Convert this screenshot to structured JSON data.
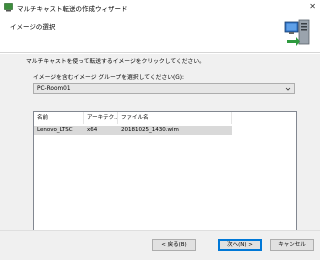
{
  "window": {
    "title": "マルチキャスト転送の作成ウィザード"
  },
  "header": {
    "title": "イメージの選択"
  },
  "content": {
    "instruction": "マルチキャストを使って転送するイメージをクリックしてください。",
    "group_label": "イメージを含むイメージ グループを選択してください(G):",
    "group_select": {
      "value": "PC-Room01"
    },
    "image_list": {
      "columns": [
        "名前",
        "アーキテク...",
        "ファイル名"
      ],
      "rows": [
        {
          "name": "Lenovo_LTSC",
          "arch": "x64",
          "file": "20181025_1430.wim"
        }
      ]
    }
  },
  "footer": {
    "back_label": "< 戻る(B)",
    "next_label": "次へ(N) >",
    "cancel_label": "キャンセル"
  }
}
